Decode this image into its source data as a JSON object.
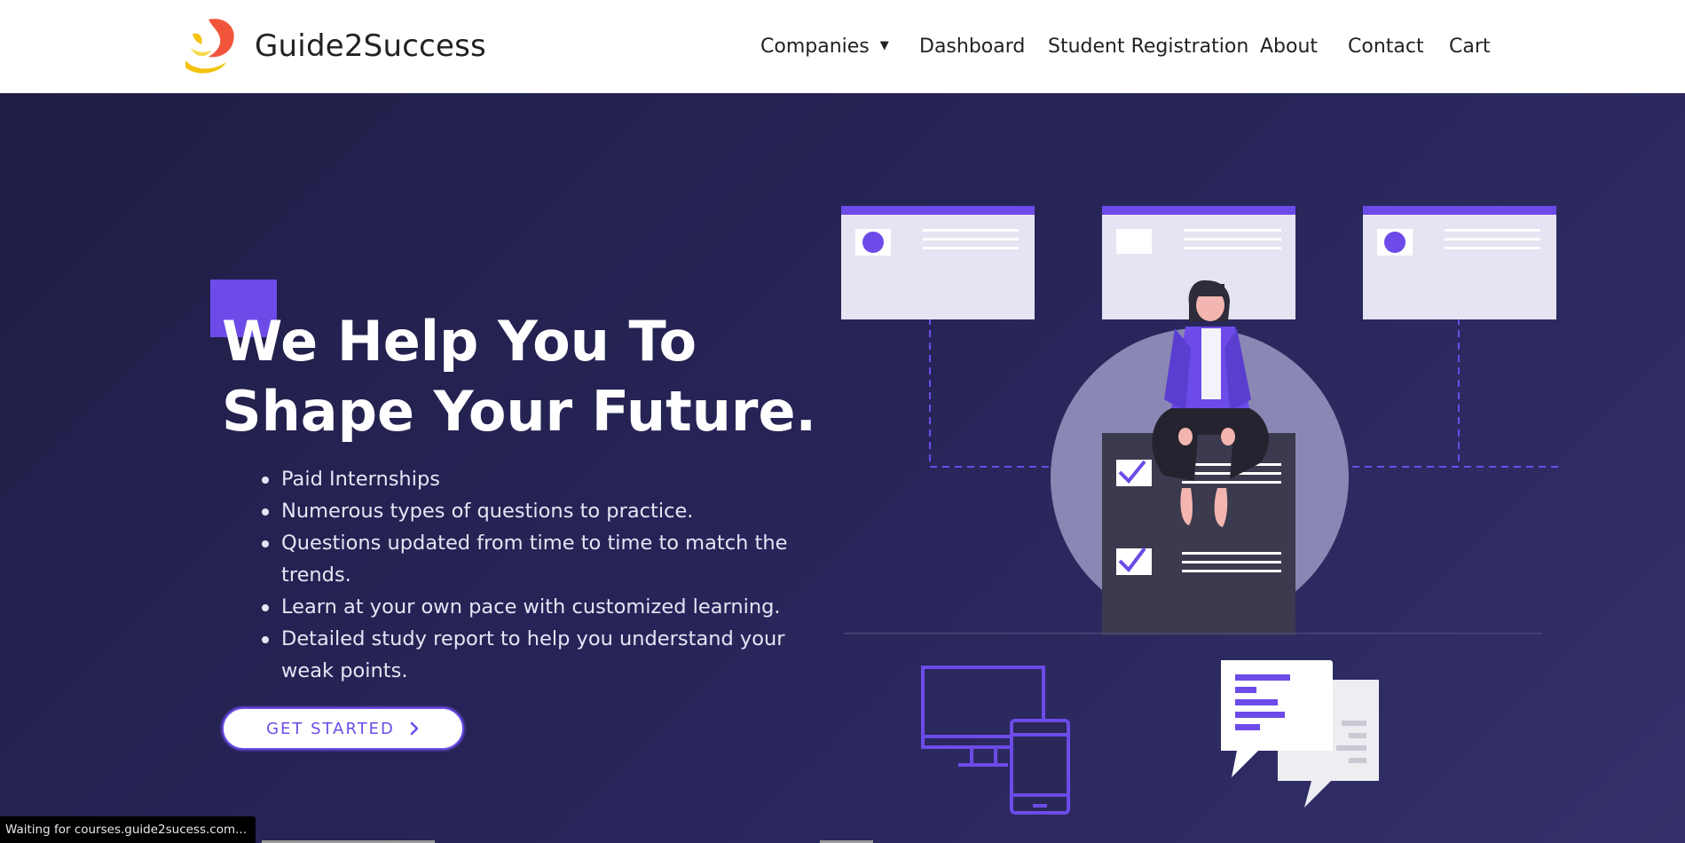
{
  "brand": {
    "name": "Guide2Success",
    "logo_colors": {
      "flame": "#f0553b",
      "swoosh": "#f4c20d"
    }
  },
  "nav": {
    "items": [
      {
        "label": "Companies",
        "has_dropdown": true
      },
      {
        "label": "Dashboard"
      },
      {
        "label": "Student Registration"
      },
      {
        "label": "About"
      },
      {
        "label": "Contact"
      },
      {
        "label": "Cart"
      }
    ]
  },
  "hero": {
    "headline_line1": "We Help You To",
    "headline_line2": "Shape Your Future.",
    "bullets": [
      "Paid Internships",
      "Numerous types of questions to practice.",
      "Questions updated from time to time to match the trends.",
      "Learn at your own pace with customized learning.",
      "Detailed study report to help you understand your weak points."
    ],
    "cta_label": "GET STARTED"
  },
  "status_bar": {
    "text": "Waiting for courses.guide2sucess.com..."
  },
  "colors": {
    "accent": "#6c4be8",
    "hero_bg": "#252450",
    "header_bg": "#ffffff"
  }
}
